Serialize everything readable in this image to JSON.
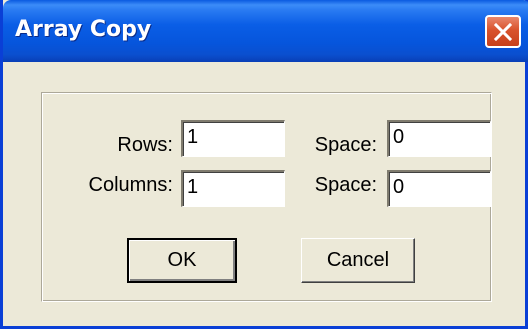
{
  "window": {
    "title": "Array Copy",
    "close_icon": "close-x-icon"
  },
  "form": {
    "rows_label": "Rows:",
    "rows_value": "1",
    "rows_space_label": "Space:",
    "rows_space_value": "0",
    "columns_label": "Columns:",
    "columns_value": "1",
    "columns_space_label": "Space:",
    "columns_space_value": "0"
  },
  "buttons": {
    "ok_label": "OK",
    "cancel_label": "Cancel"
  },
  "colors": {
    "titlebar": "#0655dc",
    "close_button": "#d9532c",
    "dialog_background": "#ece9d8"
  }
}
